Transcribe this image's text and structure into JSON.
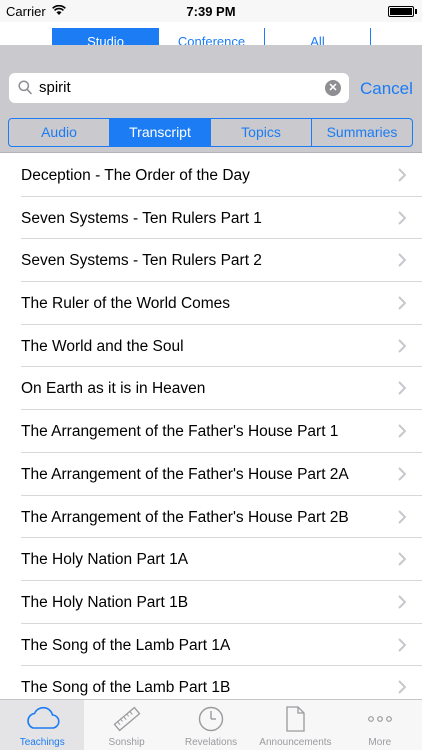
{
  "status": {
    "carrier": "Carrier",
    "time": "7:39 PM"
  },
  "source_segment": {
    "items": [
      "Studio",
      "Conference",
      "All"
    ],
    "selected": "Studio"
  },
  "search": {
    "query": "spirit",
    "cancel_label": "Cancel"
  },
  "category_segment": {
    "items": [
      "Audio",
      "Transcript",
      "Topics",
      "Summaries"
    ],
    "selected": "Transcript"
  },
  "results": [
    "Deception - The Order of the Day",
    "Seven Systems - Ten Rulers Part 1",
    "Seven Systems - Ten Rulers Part 2",
    "The Ruler of the World Comes",
    "The World and the Soul",
    "On Earth as it is in Heaven",
    "The Arrangement of the Father's House Part 1",
    "The Arrangement of the Father's House Part 2A",
    "The Arrangement of the Father's House Part 2B",
    "The Holy Nation Part 1A",
    "The Holy Nation Part 1B",
    "The Song of the Lamb Part 1A",
    "The Song of the Lamb Part 1B"
  ],
  "tabs": [
    {
      "label": "Teachings",
      "icon": "cloud-icon",
      "active": true
    },
    {
      "label": "Sonship",
      "icon": "ruler-icon",
      "active": false
    },
    {
      "label": "Revelations",
      "icon": "clock-icon",
      "active": false
    },
    {
      "label": "Announcements",
      "icon": "document-icon",
      "active": false
    },
    {
      "label": "More",
      "icon": "more-icon",
      "active": false
    }
  ],
  "colors": {
    "accent": "#1c7cf4",
    "search_bg": "#c9c9ce",
    "tab_inactive": "#9a9a9f"
  }
}
